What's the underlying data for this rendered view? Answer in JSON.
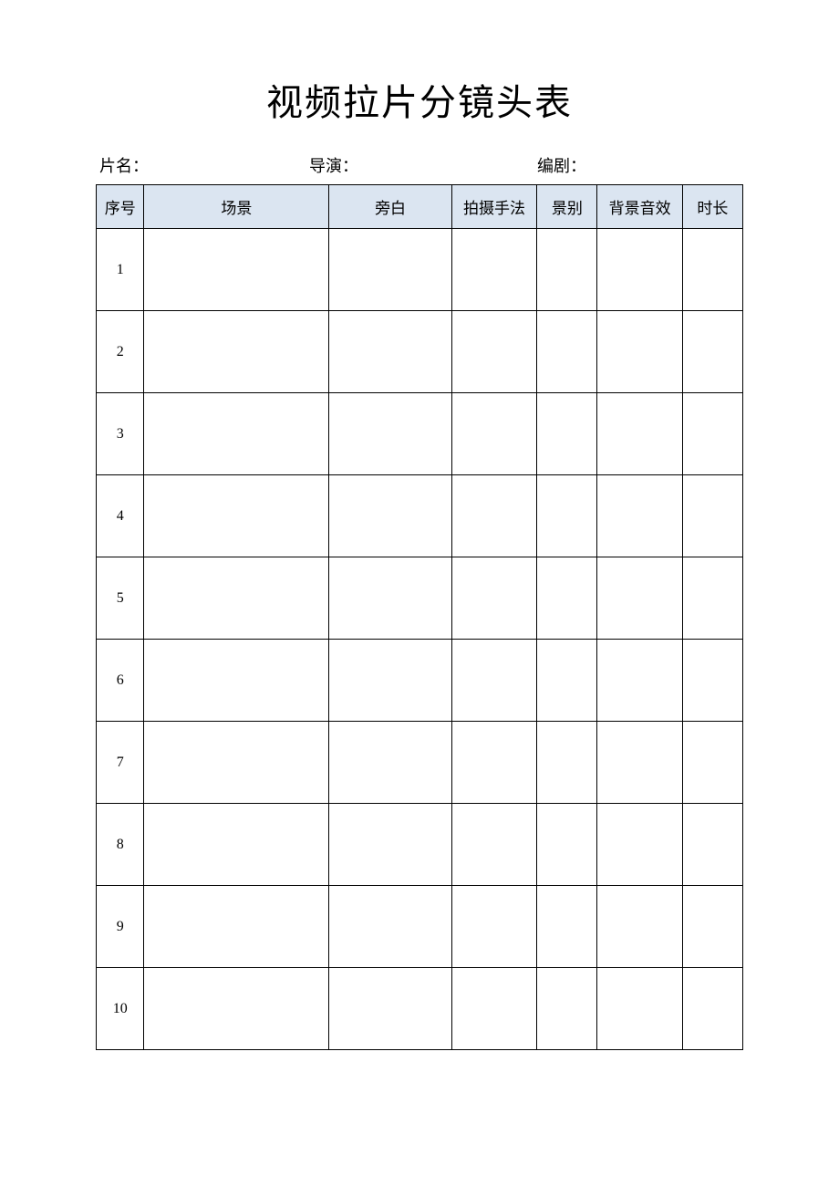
{
  "title": "视频拉片分镜头表",
  "meta": {
    "film_label": "片名：",
    "director_label": "导演：",
    "writer_label": "编剧："
  },
  "columns": {
    "index": "序号",
    "scene": "场景",
    "narration": "旁白",
    "technique": "拍摄手法",
    "shot_type": "景别",
    "bg_sound": "背景音效",
    "duration": "时长"
  },
  "rows": [
    {
      "index": "1",
      "scene": "",
      "narration": "",
      "technique": "",
      "shot_type": "",
      "bg_sound": "",
      "duration": ""
    },
    {
      "index": "2",
      "scene": "",
      "narration": "",
      "technique": "",
      "shot_type": "",
      "bg_sound": "",
      "duration": ""
    },
    {
      "index": "3",
      "scene": "",
      "narration": "",
      "technique": "",
      "shot_type": "",
      "bg_sound": "",
      "duration": ""
    },
    {
      "index": "4",
      "scene": "",
      "narration": "",
      "technique": "",
      "shot_type": "",
      "bg_sound": "",
      "duration": ""
    },
    {
      "index": "5",
      "scene": "",
      "narration": "",
      "technique": "",
      "shot_type": "",
      "bg_sound": "",
      "duration": ""
    },
    {
      "index": "6",
      "scene": "",
      "narration": "",
      "technique": "",
      "shot_type": "",
      "bg_sound": "",
      "duration": ""
    },
    {
      "index": "7",
      "scene": "",
      "narration": "",
      "technique": "",
      "shot_type": "",
      "bg_sound": "",
      "duration": ""
    },
    {
      "index": "8",
      "scene": "",
      "narration": "",
      "technique": "",
      "shot_type": "",
      "bg_sound": "",
      "duration": ""
    },
    {
      "index": "9",
      "scene": "",
      "narration": "",
      "technique": "",
      "shot_type": "",
      "bg_sound": "",
      "duration": ""
    },
    {
      "index": "10",
      "scene": "",
      "narration": "",
      "technique": "",
      "shot_type": "",
      "bg_sound": "",
      "duration": ""
    }
  ]
}
